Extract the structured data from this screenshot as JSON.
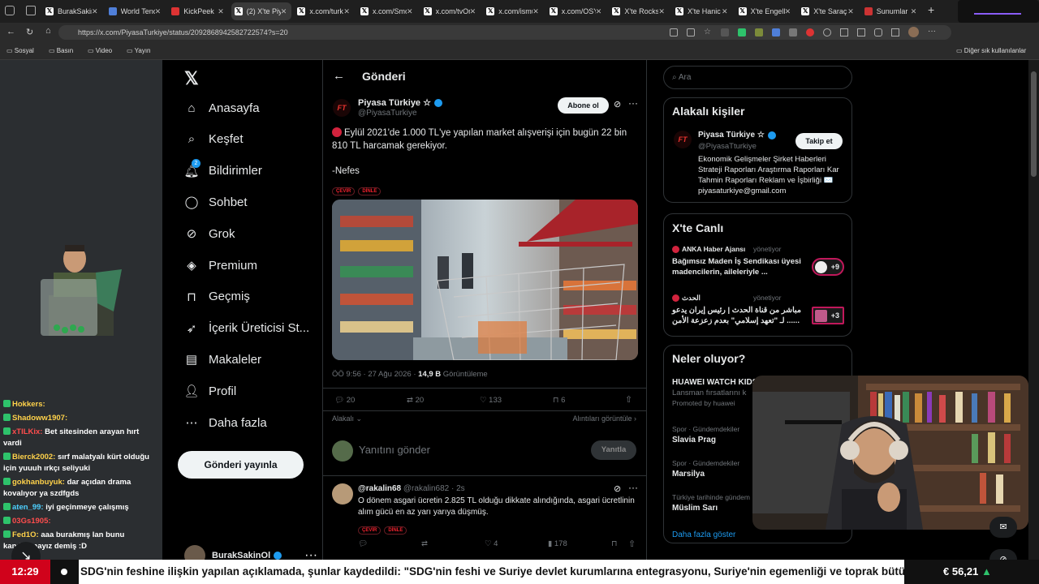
{
  "browser": {
    "tabs": [
      {
        "label": "BurakSakin",
        "icon": "x"
      },
      {
        "label": "World Tenc",
        "icon": "globe"
      },
      {
        "label": "KickPeek",
        "icon": "kp"
      },
      {
        "label": "(2) X'te Piy",
        "icon": "x",
        "active": true
      },
      {
        "label": "x.com/turk",
        "icon": "x"
      },
      {
        "label": "x.com/Smo",
        "icon": "x"
      },
      {
        "label": "x.com/tvOr",
        "icon": "x"
      },
      {
        "label": "x.com/ismu",
        "icon": "x"
      },
      {
        "label": "x.com/OSY",
        "icon": "x"
      },
      {
        "label": "X'te Rockst",
        "icon": "x"
      },
      {
        "label": "X'te Hanic",
        "icon": "x"
      },
      {
        "label": "X'te Engelli",
        "icon": "x"
      },
      {
        "label": "X'te Saraç",
        "icon": "x"
      },
      {
        "label": "Sunumlar",
        "icon": "s"
      }
    ],
    "url": "https://x.com/PiyasaTurkiye/status/2092868942582722574?s=20",
    "bookmarks": [
      "Sosyal",
      "Basın",
      "Video",
      "Yayın"
    ],
    "other_bookmarks": "Diğer sık kullanılanlar"
  },
  "chat": [
    {
      "user": "Hokkers:",
      "text": "",
      "color": "#ffd24a"
    },
    {
      "user": "Shadoww1907:",
      "text": "",
      "color": "#ffd24a"
    },
    {
      "user": "xTILKix:",
      "text": "Bet sitesinden arayan hırt vardi",
      "color": "#ff4d4d"
    },
    {
      "user": "Bierck2002:",
      "text": "sırf malatyalı kürt olduğu için yuuuh ırkçı seliyuki",
      "color": "#ffd24a"
    },
    {
      "user": "gokhanbuyuk:",
      "text": "dar açıdan drama kovalıyor ya szdfgds",
      "color": "#ffd24a"
    },
    {
      "user": "aten_99:",
      "text": "iyi geçinmeye çalışmış",
      "color": "#4dd0ff"
    },
    {
      "user": "03Gs1905:",
      "text": "",
      "color": "#ff4d4d"
    },
    {
      "user": "Fed1O:",
      "text": "aaa burakmış lan bunu kandıramayız demiş :D",
      "color": "#ffd24a"
    }
  ],
  "x_nav": {
    "items": [
      "Anasayfa",
      "Keşfet",
      "Bildirimler",
      "Sohbet",
      "Grok",
      "Premium",
      "Geçmiş",
      "İçerik Üreticisi St...",
      "Makaleler",
      "Profil",
      "Daha fazla"
    ],
    "notif_badge": "2",
    "post_button": "Gönderi yayınla",
    "account_name": "BurakSakinOl"
  },
  "post": {
    "header": "Gönderi",
    "author": "Piyasa Türkiye",
    "star": "☆",
    "handle": "@PiyasaTurkiye",
    "subscribe": "Abone ol",
    "text": "Eylül 2021'de 1.000 TL'ye yapılan market alışverişi için bugün 22 bin 810 TL harcamak gerekiyor.",
    "source": "-Nefes",
    "translate": "ÇEVİR",
    "listen": "DİNLE",
    "meta_time": "ÖÖ 9:56 · 27 Ağu 2026 · ",
    "views": "14,9 B",
    "views_label": " Görüntüleme",
    "replies": "20",
    "reposts": "20",
    "likes": "133",
    "bookmarks": "6",
    "relevant": "Alakalı",
    "quotes": "Alıntıları görüntüle",
    "reply_placeholder": "Yanıtını gönder",
    "reply_button": "Yanıtla"
  },
  "reply": {
    "author": "@rakalin68",
    "handle": "@rakalin682 · 2s",
    "text": "O dönem asgari ücretin 2.825 TL olduğu dikkate alındığında, asgari ücretlinin alım gücü en az yarı yarıya düşmüş.",
    "likes": "4",
    "views": "178"
  },
  "sidebar": {
    "search_placeholder": "Ara",
    "people_title": "Alakalı kişiler",
    "person_name": "Piyasa Türkiye",
    "person_handle": "@PiyasaTturkiye",
    "follow": "Takip et",
    "person_bio": "Ekonomik Gelişmeler Şirket Haberleri Strateji Raporları Araştırma Raporları Kar Tahmin Raporları Reklam ve İşbirliği ✉️ piyasaturkiye@gmail.com",
    "live_title": "X'te Canlı",
    "live": [
      {
        "source": "ANKA Haber Ajansı",
        "role": "yönetiyor",
        "text": "Bağımsız Maden İş Sendikası üyesi madencilerin, aileleriyle ...",
        "count": "+9"
      },
      {
        "source": "الحدث",
        "role": "yönetiyor",
        "text": "مباشر من قناة الحدث | رئيس إيران يدعو ... لـ \"تعهد إسلامي\" بعدم زعزعة الأمن...",
        "count": "+3"
      }
    ],
    "trends_title": "Neler oluyor?",
    "trends": [
      {
        "meta": "",
        "title": "HUAWEI WATCH KIDS",
        "sub": "Lansman fırsatlarını k",
        "promo": "Promoted by huawei"
      },
      {
        "meta": "Spor · Gündemdekiler",
        "title": "Slavia Prag",
        "sub": "",
        "promo": ""
      },
      {
        "meta": "Spor · Gündemdekiler",
        "title": "Marsilya",
        "sub": "",
        "promo": ""
      },
      {
        "meta": "Türkiye tarihinde gündem",
        "title": "Müslim Sarı",
        "sub": "",
        "promo": ""
      }
    ],
    "show_more": "Daha fazla göster"
  },
  "ticker": {
    "time": "12:29",
    "text": "SDG'nin feshine ilişkin yapılan açıklamada, şunlar kaydedildi: \"SDG'nin feshi ve Suriye devlet kurumlarına entegrasyonu, Suriye'nin egemenliği ve toprak bütü",
    "price": "€ 56,21"
  }
}
